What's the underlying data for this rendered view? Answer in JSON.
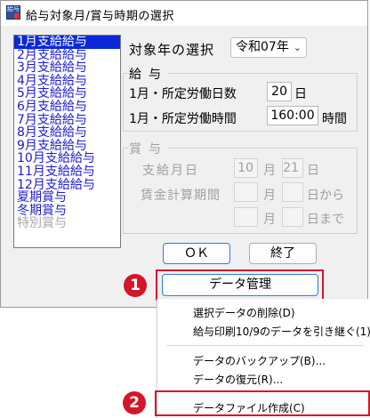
{
  "window": {
    "title": "給与対象月/賞与時期の選択",
    "icon_name": "app-icon",
    "icon_text": "給与"
  },
  "list": [
    {
      "label": "1月支給給与",
      "state": "selected"
    },
    {
      "label": "2月支給給与",
      "state": "normal"
    },
    {
      "label": "3月支給給与",
      "state": "normal"
    },
    {
      "label": "4月支給給与",
      "state": "normal"
    },
    {
      "label": "5月支給給与",
      "state": "normal"
    },
    {
      "label": "6月支給給与",
      "state": "normal"
    },
    {
      "label": "7月支給給与",
      "state": "normal"
    },
    {
      "label": "8月支給給与",
      "state": "normal"
    },
    {
      "label": "9月支給給与",
      "state": "normal"
    },
    {
      "label": "10月支給給与",
      "state": "normal"
    },
    {
      "label": "11月支給給与",
      "state": "normal"
    },
    {
      "label": "12月支給給与",
      "state": "normal"
    },
    {
      "label": "夏期賞与",
      "state": "normal"
    },
    {
      "label": "冬期賞与",
      "state": "normal"
    },
    {
      "label": "特別賞与",
      "state": "disabled"
    }
  ],
  "year": {
    "label": "対象年の選択",
    "value": "令和07年"
  },
  "salary": {
    "title": "給与",
    "days_label": "1月・所定労働日数",
    "days_value": "20",
    "days_unit": "日",
    "hours_label": "1月・所定労働時間",
    "hours_value": "160:00",
    "hours_unit": "時間"
  },
  "bonus": {
    "title": "賞与",
    "pay_date_label": "支給月日",
    "pay_month": "10",
    "month_unit": "月",
    "pay_day": "21",
    "day_unit": "日",
    "period_label": "賃金計算期間",
    "from_month_unit": "月",
    "from_suffix": "日から",
    "to_month_unit": "月",
    "to_suffix": "日まで"
  },
  "buttons": {
    "ok": "ＯＫ",
    "close": "終了",
    "data_manage": "データ管理"
  },
  "menu": {
    "items": [
      "選択データの削除(D)",
      "給与印刷10/9のデータを引き継ぐ(1)",
      "データのバックアップ(B)...",
      "データの復元(R)...",
      "データファイル作成(C)"
    ]
  },
  "annotations": {
    "badge1": "1",
    "badge2": "2",
    "highlight_color": "#d5152a"
  },
  "colors": {
    "selection": "#0a28d6",
    "list_text": "#1c1ccd",
    "disabled": "#a0a0a0"
  }
}
